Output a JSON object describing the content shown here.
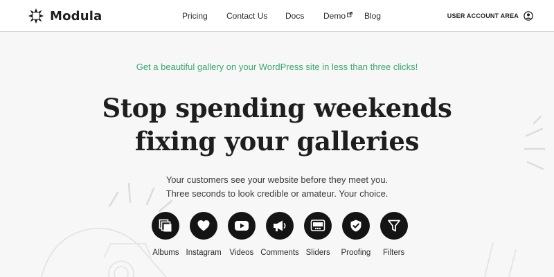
{
  "header": {
    "brand": "Modula",
    "nav": [
      {
        "label": "Pricing"
      },
      {
        "label": "Contact Us"
      },
      {
        "label": "Docs"
      },
      {
        "label": "Demo",
        "icon": "external-link-icon"
      },
      {
        "label": "Blog"
      }
    ],
    "account_label": "USER ACCOUNT AREA",
    "account_icon": "user-circle-icon"
  },
  "hero": {
    "tagline": "Get a beautiful gallery on your WordPress site in less than three clicks!",
    "headline_line1": "Stop spending weekends",
    "headline_line2": "fixing your galleries",
    "sub_line1": "Your customers see your website before they meet you.",
    "sub_line2": "Three seconds to look credible or amateur. Your choice."
  },
  "features": [
    {
      "label": "Albums",
      "icon": "albums-icon"
    },
    {
      "label": "Instagram",
      "icon": "heart-icon"
    },
    {
      "label": "Videos",
      "icon": "play-icon"
    },
    {
      "label": "Comments",
      "icon": "megaphone-icon"
    },
    {
      "label": "Sliders",
      "icon": "slider-icon"
    },
    {
      "label": "Proofing",
      "icon": "shield-check-icon"
    },
    {
      "label": "Filters",
      "icon": "filter-icon"
    }
  ],
  "colors": {
    "accent": "#3aa773",
    "background": "#f7f7f7",
    "header_bg": "#ffffff",
    "icon_circle": "#141414",
    "text": "#1e1e1e"
  }
}
